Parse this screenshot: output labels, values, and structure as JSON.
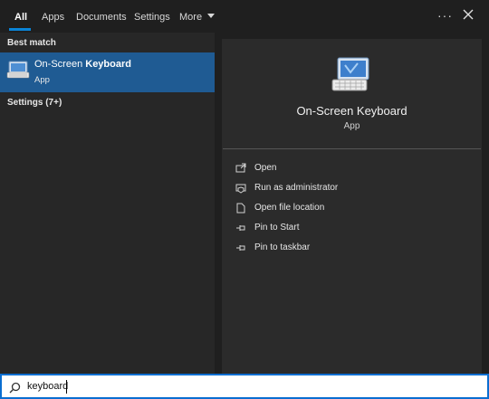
{
  "tabs": {
    "all": "All",
    "apps": "Apps",
    "documents": "Documents",
    "settings": "Settings",
    "more": "More"
  },
  "left": {
    "best_match_header": "Best match",
    "best_title_prefix": "On-Screen ",
    "best_title_bold": "Keyboard",
    "best_subtitle": "App",
    "settings_header": "Settings (7+)"
  },
  "preview": {
    "title": "On-Screen Keyboard",
    "subtitle": "App",
    "actions": [
      {
        "label": "Open",
        "icon": "open-icon"
      },
      {
        "label": "Run as administrator",
        "icon": "shield-icon"
      },
      {
        "label": "Open file location",
        "icon": "file-location-icon"
      },
      {
        "label": "Pin to Start",
        "icon": "pin-icon"
      },
      {
        "label": "Pin to taskbar",
        "icon": "pin-icon"
      }
    ]
  },
  "search": {
    "value": "keyboard"
  },
  "colors": {
    "accent": "#0a84d6",
    "selected_row": "#1f5b93"
  }
}
